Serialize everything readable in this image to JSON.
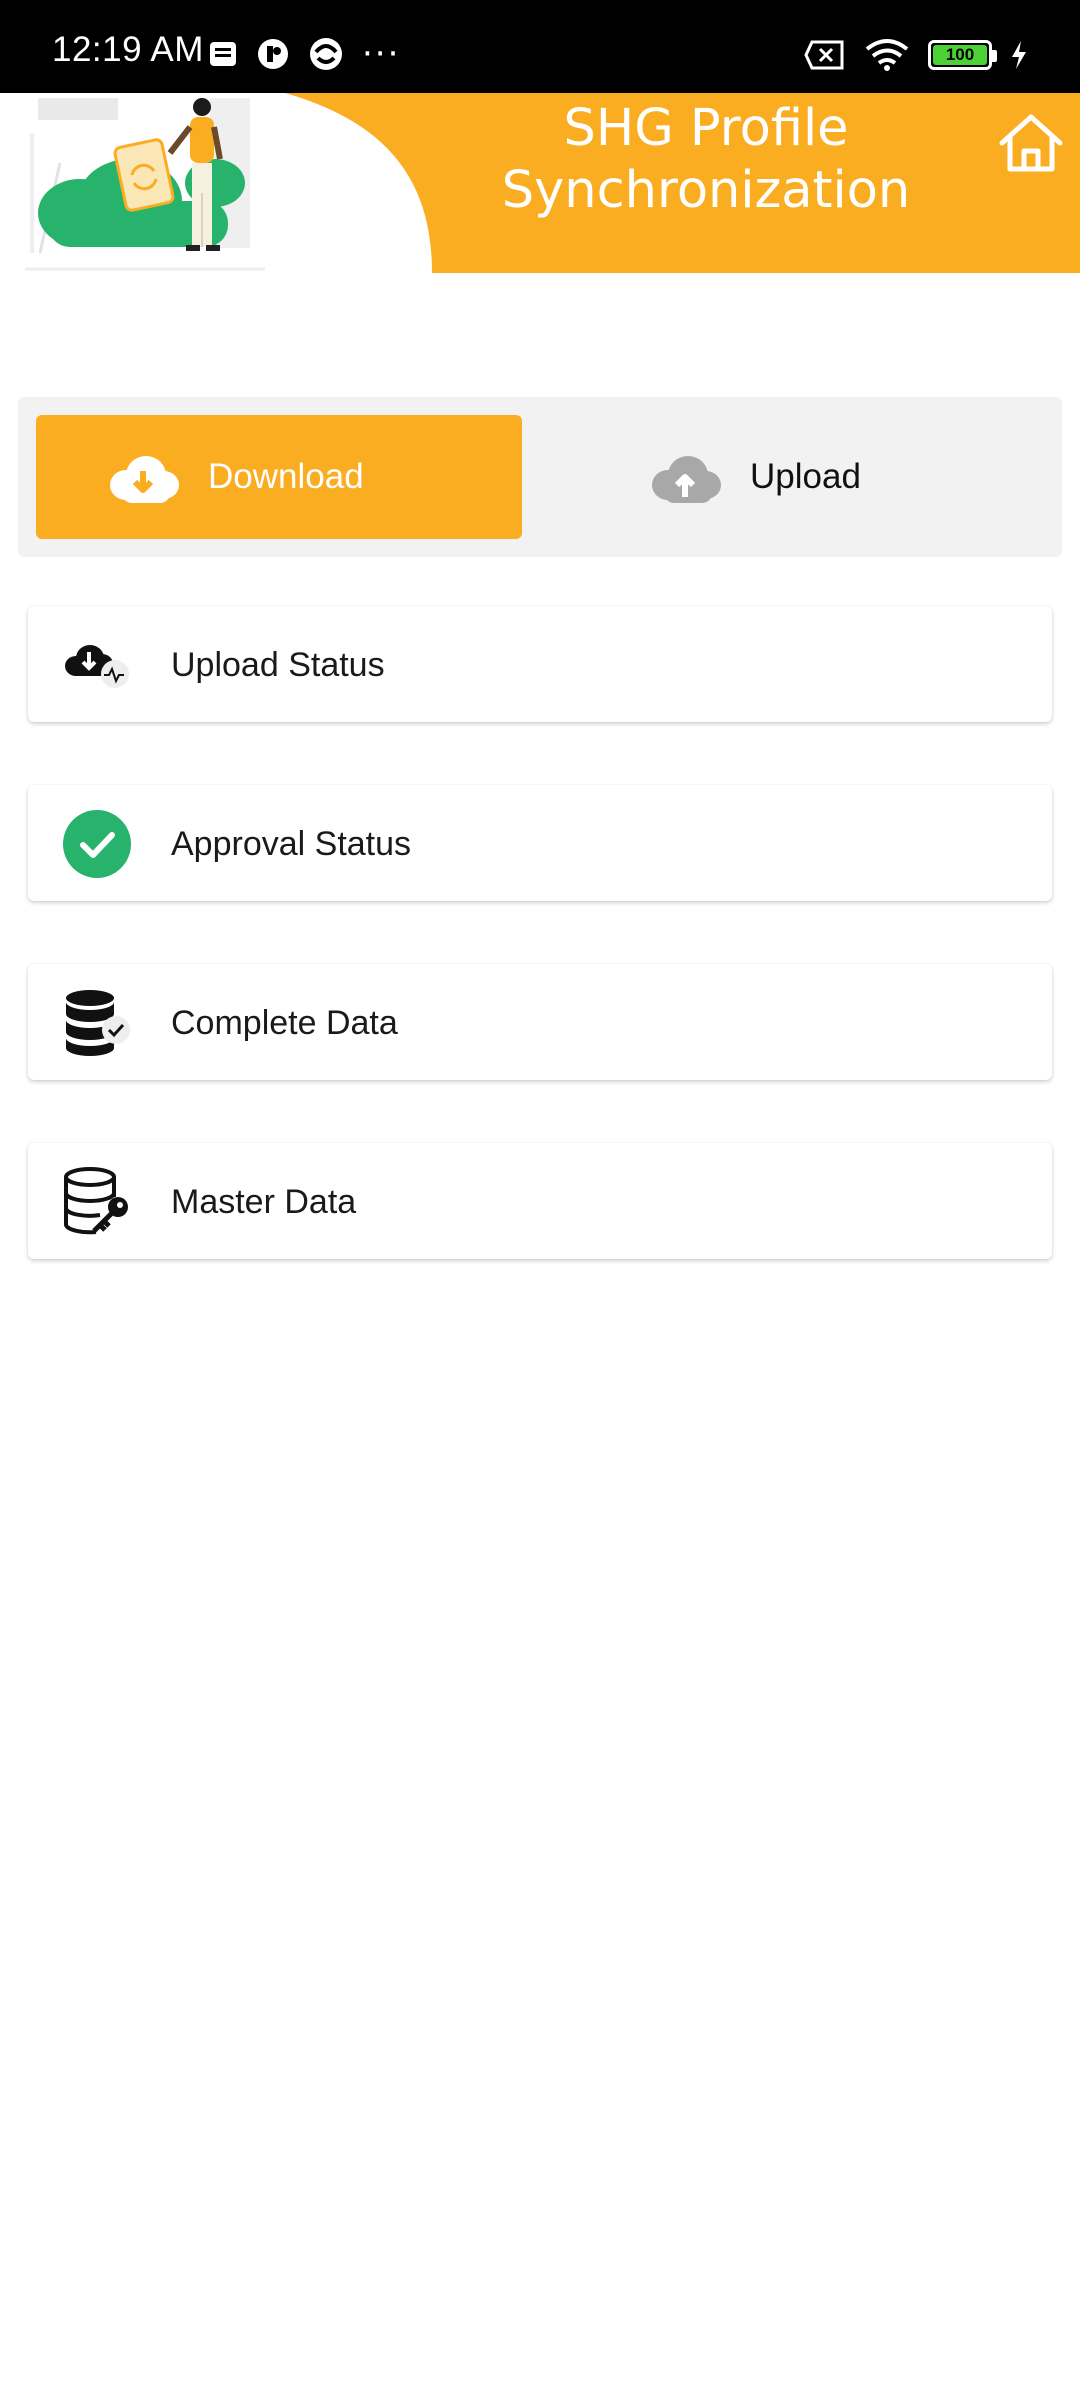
{
  "status_bar": {
    "time": "12:19 AM",
    "battery": "100",
    "icons": [
      "notification-icon",
      "app-icon-1",
      "app-icon-2",
      "more-dots-icon",
      "no-sim-icon",
      "wifi-icon",
      "battery-icon",
      "charging-icon"
    ],
    "more_dots": "···"
  },
  "header": {
    "title": "SHG Profile Synchronization",
    "accent_color": "#fbad22"
  },
  "tabs": {
    "download_label": "Download",
    "upload_label": "Upload",
    "selected": "Download"
  },
  "menu": {
    "items": [
      {
        "label": "Upload Status",
        "icon": "cloud-download-activity-icon"
      },
      {
        "label": "Approval Status",
        "icon": "check-circle-icon"
      },
      {
        "label": "Complete Data",
        "icon": "database-check-icon"
      },
      {
        "label": "Master Data",
        "icon": "database-key-icon"
      }
    ]
  },
  "colors": {
    "primary": "#fbad22",
    "success": "#27b36b",
    "segment_bg": "#f2f2f2"
  }
}
